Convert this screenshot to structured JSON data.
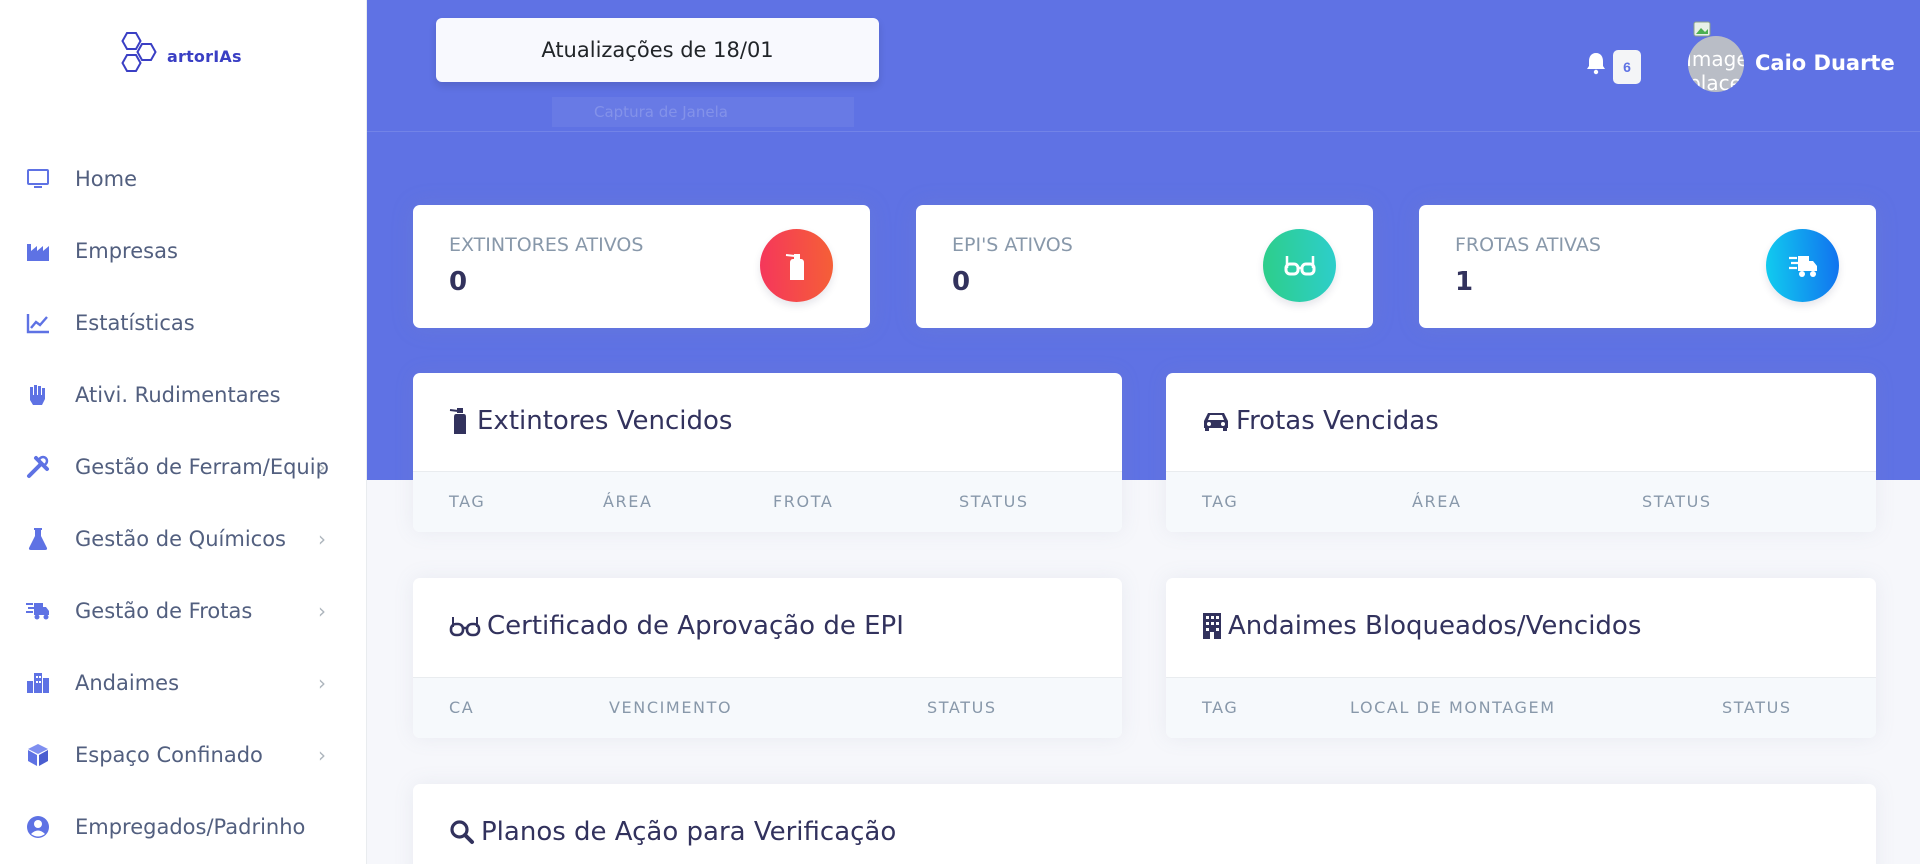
{
  "brand": {
    "name": "artorIAs"
  },
  "sidebar": {
    "items": [
      {
        "label": "Home",
        "icon": "monitor-icon",
        "chevron": false
      },
      {
        "label": "Empresas",
        "icon": "industry-icon",
        "chevron": false
      },
      {
        "label": "Estatísticas",
        "icon": "chart-line-icon",
        "chevron": false
      },
      {
        "label": "Ativi. Rudimentares",
        "icon": "fist-icon",
        "chevron": false
      },
      {
        "label": "Gestão de Ferram/Equip",
        "icon": "tools-icon",
        "chevron": true
      },
      {
        "label": "Gestão de Químicos",
        "icon": "flask-icon",
        "chevron": true
      },
      {
        "label": "Gestão de Frotas",
        "icon": "truck-fast-icon",
        "chevron": true
      },
      {
        "label": "Andaimes",
        "icon": "buildings-icon",
        "chevron": true
      },
      {
        "label": "Espaço Confinado",
        "icon": "cube-icon",
        "chevron": true
      },
      {
        "label": "Empregados/Padrinho",
        "icon": "user-circle-icon",
        "chevron": false
      }
    ],
    "chevron_glyph": "›"
  },
  "header": {
    "update_button": "Atualizações de 18/01",
    "ghost_tooltip": "Captura de Janela",
    "notifications_count": "6",
    "avatar_alt": "Image place",
    "user_name": "Caio Duarte"
  },
  "stats": [
    {
      "label": "EXTINTORES ATIVOS",
      "value": "0",
      "icon": "fire-extinguisher-icon",
      "color": "#f5365c"
    },
    {
      "label": "EPI'S ATIVOS",
      "value": "0",
      "icon": "glasses-icon",
      "color": "#2dce89"
    },
    {
      "label": "FROTAS ATIVAS",
      "value": "1",
      "icon": "truck-fast-icon",
      "color": "#11cdef"
    }
  ],
  "tables": {
    "extintores": {
      "title": "Extintores Vencidos",
      "icon": "fire-extinguisher-icon",
      "columns": [
        "TAG",
        "ÁREA",
        "FROTA",
        "STATUS"
      ]
    },
    "frotas": {
      "title": "Frotas Vencidas",
      "icon": "car-icon",
      "columns": [
        "TAG",
        "ÁREA",
        "STATUS"
      ]
    },
    "certificado": {
      "title": "Certificado de Aprovação de EPI",
      "icon": "glasses-icon",
      "columns": [
        "CA",
        "VENCIMENTO",
        "STATUS"
      ]
    },
    "andaimes": {
      "title": "Andaimes Bloqueados/Vencidos",
      "icon": "building-icon",
      "columns": [
        "TAG",
        "LOCAL DE MONTAGEM",
        "STATUS"
      ]
    },
    "planos": {
      "title": "Planos de Ação para Verificação",
      "icon": "search-icon"
    }
  }
}
